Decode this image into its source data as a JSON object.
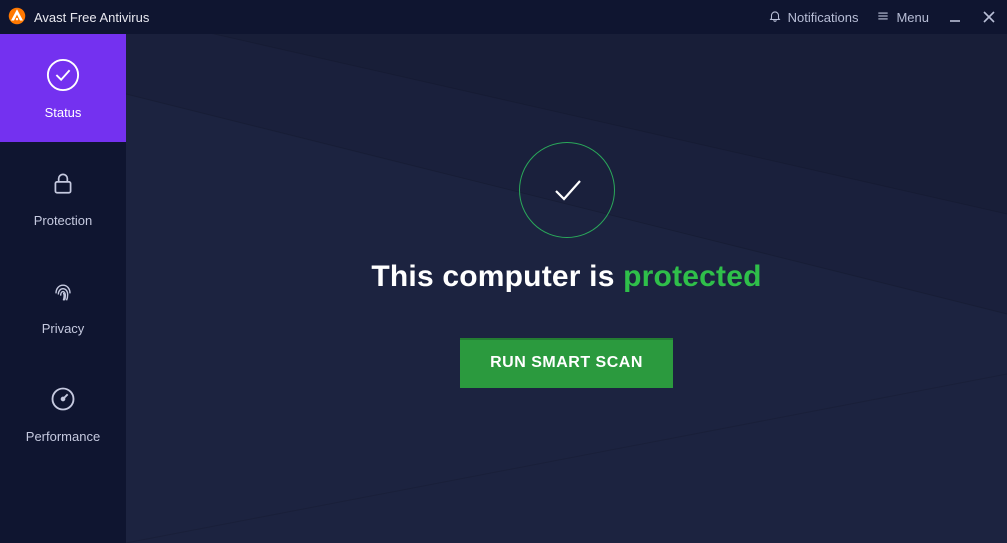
{
  "titlebar": {
    "app_name": "Avast Free Antivirus",
    "notifications_label": "Notifications",
    "menu_label": "Menu"
  },
  "sidebar": {
    "items": [
      {
        "label": "Status"
      },
      {
        "label": "Protection"
      },
      {
        "label": "Privacy"
      },
      {
        "label": "Performance"
      }
    ]
  },
  "main": {
    "headline_prefix": "This computer is ",
    "headline_status": "protected",
    "scan_button_label": "RUN SMART SCAN"
  },
  "colors": {
    "accent_purple": "#7431f0",
    "accent_green": "#2fbf4a",
    "button_green": "#2b9a3e",
    "bg_dark": "#0f1530",
    "bg_main": "#1c2340"
  }
}
